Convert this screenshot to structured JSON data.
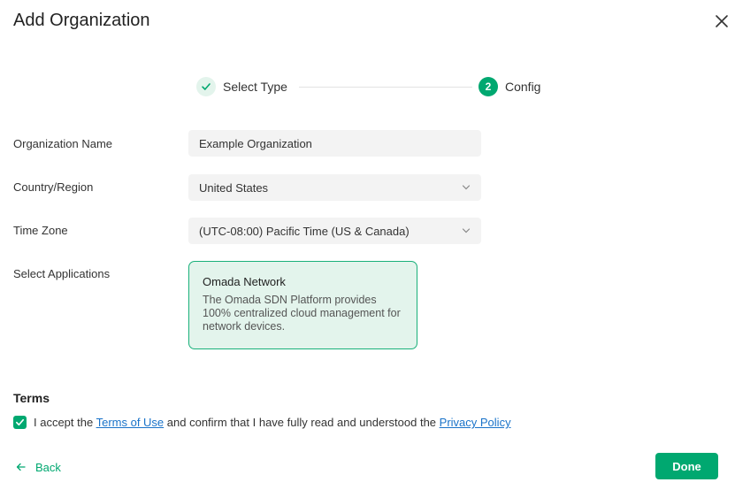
{
  "dialog": {
    "title": "Add Organization",
    "close_icon": "close-icon"
  },
  "steps": [
    {
      "label": "Select Type",
      "state": "done",
      "icon": "check-icon"
    },
    {
      "label": "Config",
      "state": "current",
      "number": "2"
    }
  ],
  "form": {
    "org_name": {
      "label": "Organization Name",
      "value": "Example Organization"
    },
    "country": {
      "label": "Country/Region",
      "value": "United States",
      "icon": "chevron-down-icon"
    },
    "timezone": {
      "label": "Time Zone",
      "value": "(UTC-08:00) Pacific Time (US & Canada)",
      "icon": "chevron-down-icon"
    },
    "applications": {
      "label": "Select Applications",
      "card": {
        "name": "Omada Network",
        "description": "The Omada SDN Platform provides 100% centralized cloud management for network devices.",
        "selected": true
      }
    }
  },
  "terms": {
    "title": "Terms",
    "checked": true,
    "text_before": "I accept the ",
    "terms_link": "Terms of Use",
    "text_middle": " and confirm that I have fully read and understood the ",
    "privacy_link": "Privacy Policy"
  },
  "footer": {
    "back_label": "Back",
    "done_label": "Done"
  },
  "colors": {
    "accent": "#00a870",
    "accent_light": "#e3f4ec",
    "link": "#1a73c9",
    "field_bg": "#f3f3f3"
  }
}
